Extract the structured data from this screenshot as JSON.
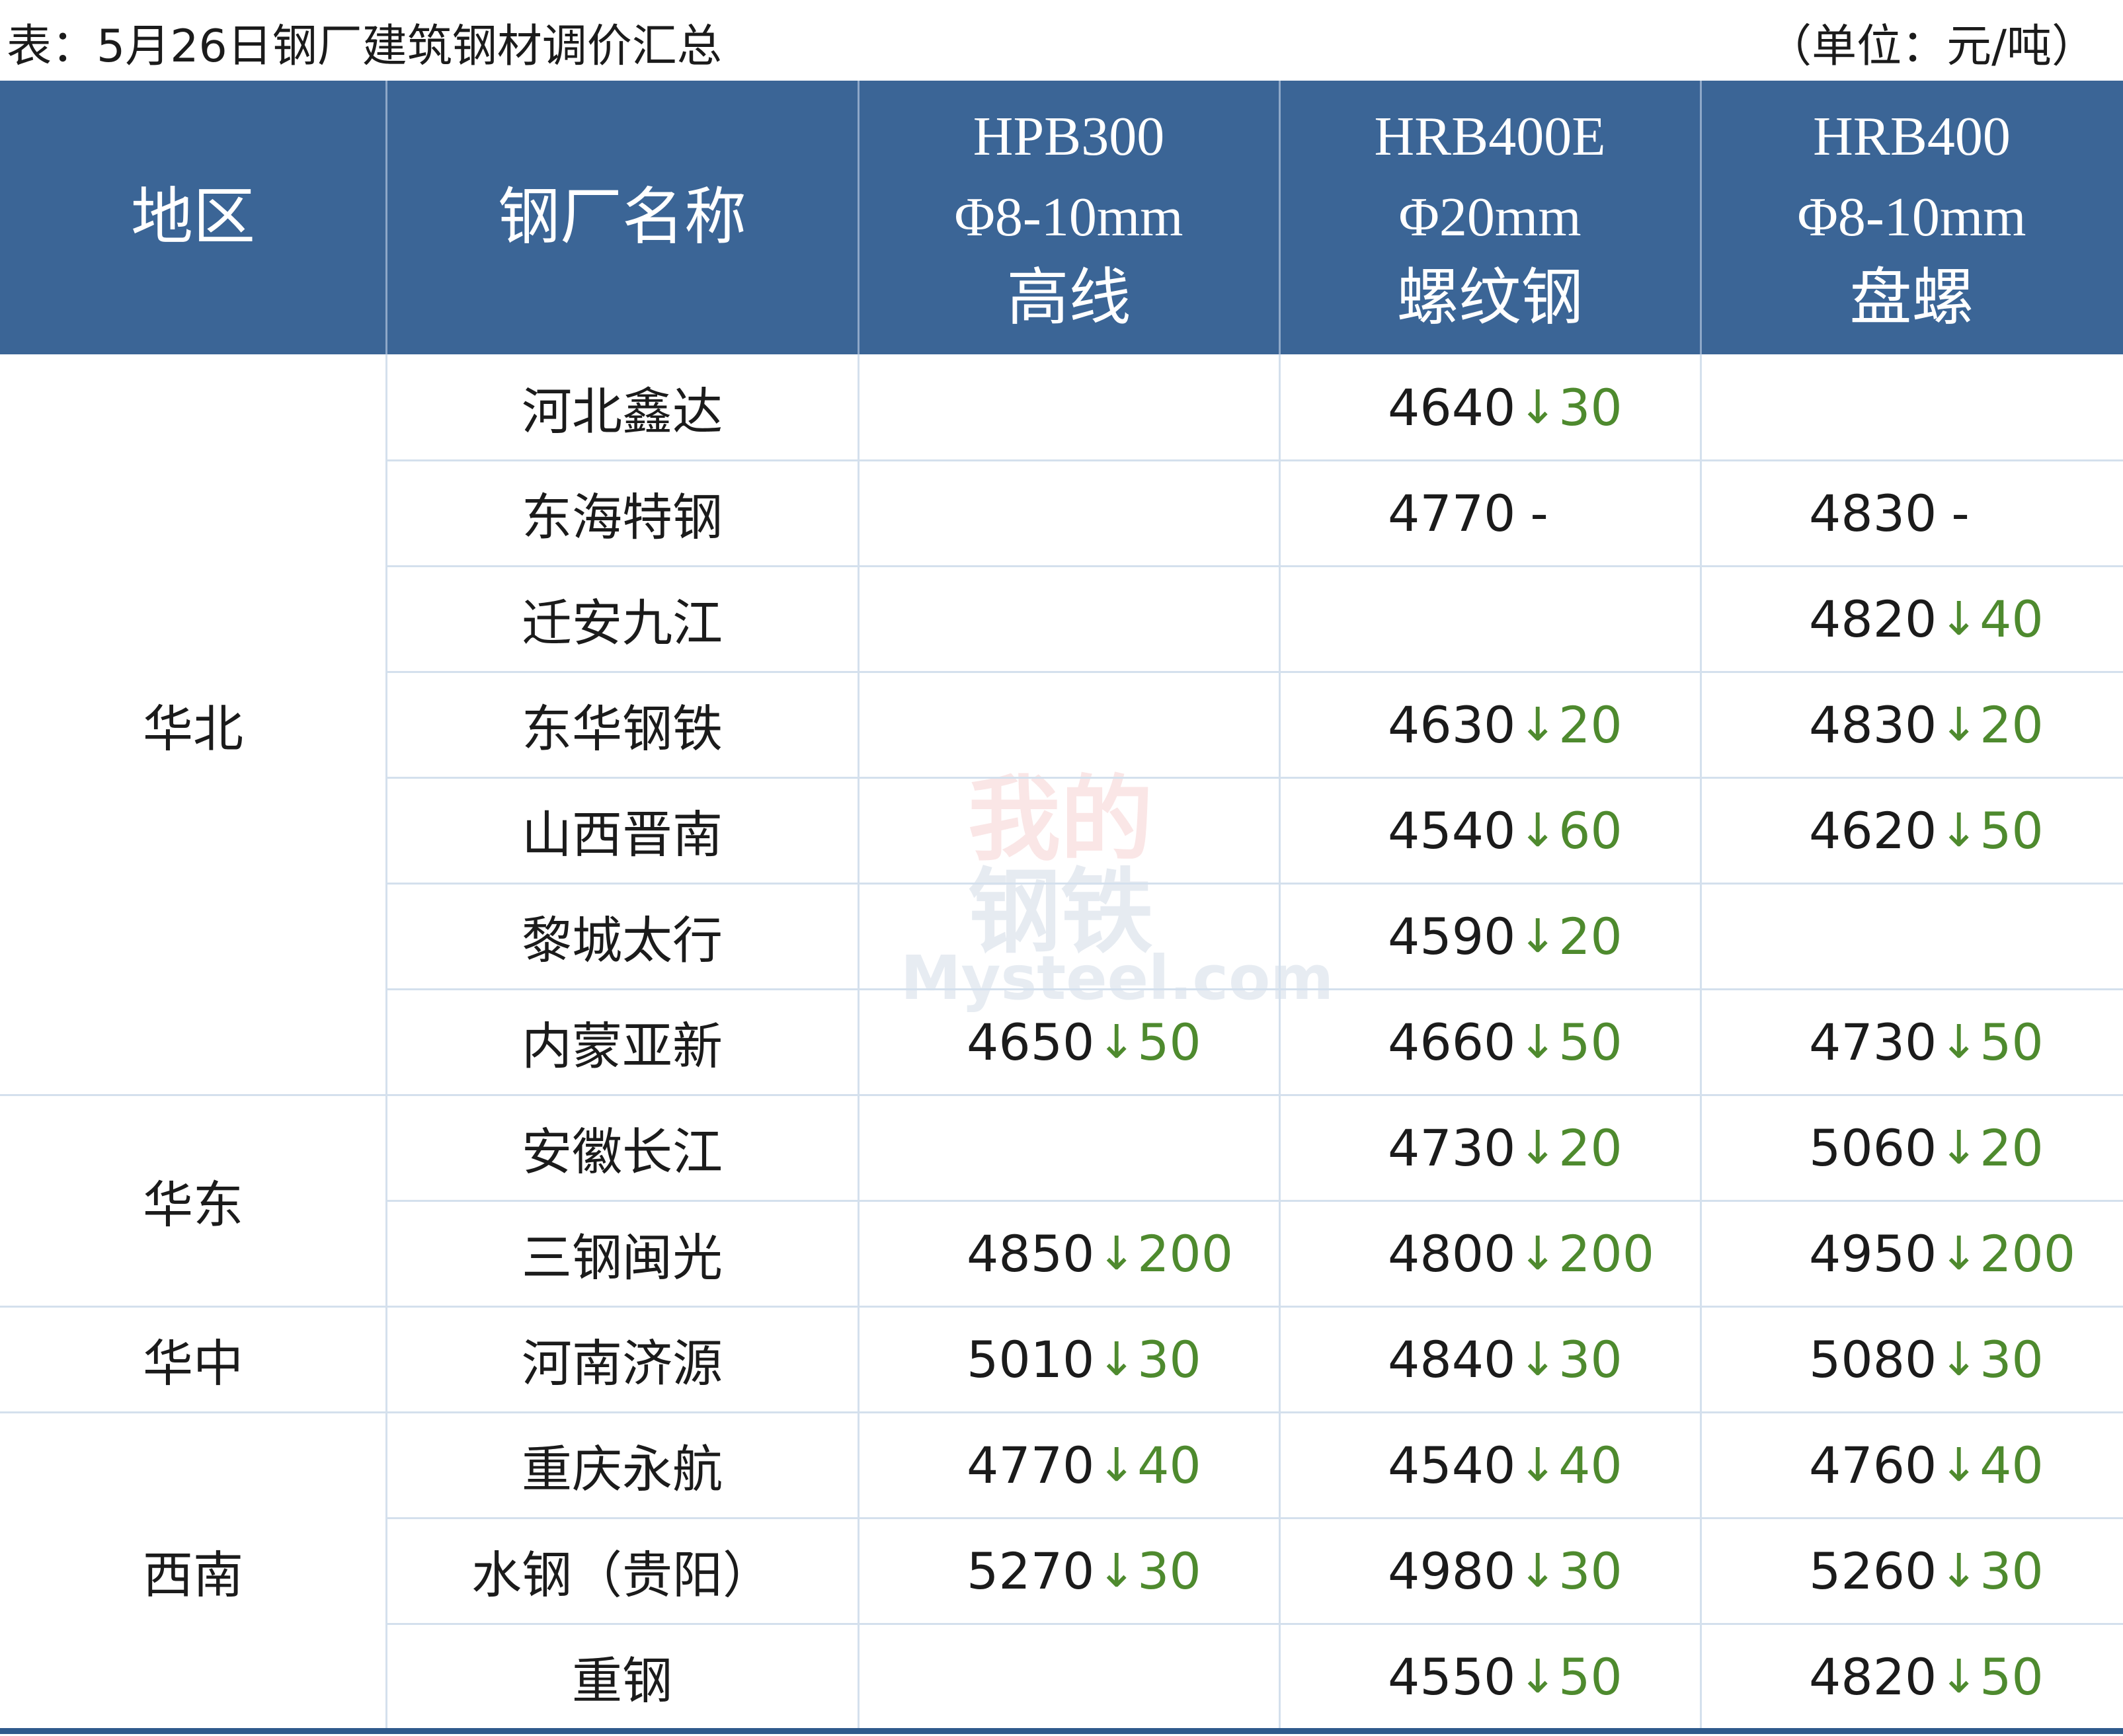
{
  "title": "表：5月26日钢厂建筑钢材调价汇总",
  "unit": "（单位：元/吨）",
  "header": {
    "region": "地区",
    "mill": "钢厂名称",
    "products": [
      {
        "grade": "HPB300",
        "spec": "Φ8-10mm",
        "type": "高线"
      },
      {
        "grade": "HRB400E",
        "spec": "Φ20mm",
        "type": "螺纹钢"
      },
      {
        "grade": "HRB400",
        "spec": "Φ8-10mm",
        "type": "盘螺"
      }
    ]
  },
  "groups": [
    {
      "region": "华北",
      "rows": [
        {
          "mill": "河北鑫达",
          "prices": [
            null,
            {
              "price": "4640",
              "arrow": "↓",
              "change": "30"
            },
            null
          ]
        },
        {
          "mill": "东海特钢",
          "prices": [
            null,
            {
              "price": "4770",
              "change": "-"
            },
            {
              "price": "4830",
              "change": "-"
            }
          ]
        },
        {
          "mill": "迁安九江",
          "prices": [
            null,
            null,
            {
              "price": "4820",
              "arrow": "↓",
              "change": "40"
            }
          ]
        },
        {
          "mill": "东华钢铁",
          "prices": [
            null,
            {
              "price": "4630",
              "arrow": "↓",
              "change": "20"
            },
            {
              "price": "4830",
              "arrow": "↓",
              "change": "20"
            }
          ]
        },
        {
          "mill": "山西晋南",
          "prices": [
            null,
            {
              "price": "4540",
              "arrow": "↓",
              "change": "60"
            },
            {
              "price": "4620",
              "arrow": "↓",
              "change": "50"
            }
          ]
        },
        {
          "mill": "黎城太行",
          "prices": [
            null,
            {
              "price": "4590",
              "arrow": "↓",
              "change": "20"
            },
            null
          ]
        },
        {
          "mill": "内蒙亚新",
          "prices": [
            {
              "price": "4650",
              "arrow": "↓",
              "change": "50"
            },
            {
              "price": "4660",
              "arrow": "↓",
              "change": "50"
            },
            {
              "price": "4730",
              "arrow": "↓",
              "change": "50"
            }
          ]
        }
      ]
    },
    {
      "region": "华东",
      "rows": [
        {
          "mill": "安徽长江",
          "prices": [
            null,
            {
              "price": "4730",
              "arrow": "↓",
              "change": "20"
            },
            {
              "price": "5060",
              "arrow": "↓",
              "change": "20"
            }
          ]
        },
        {
          "mill": "三钢闽光",
          "prices": [
            {
              "price": "4850",
              "arrow": "↓",
              "change": "200"
            },
            {
              "price": "4800",
              "arrow": "↓",
              "change": "200"
            },
            {
              "price": "4950",
              "arrow": "↓",
              "change": "200"
            }
          ]
        }
      ]
    },
    {
      "region": "华中",
      "rows": [
        {
          "mill": "河南济源",
          "prices": [
            {
              "price": "5010",
              "arrow": "↓",
              "change": "30"
            },
            {
              "price": "4840",
              "arrow": "↓",
              "change": "30"
            },
            {
              "price": "5080",
              "arrow": "↓",
              "change": "30"
            }
          ]
        }
      ]
    },
    {
      "region": "西南",
      "rows": [
        {
          "mill": "重庆永航",
          "prices": [
            {
              "price": "4770",
              "arrow": "↓",
              "change": "40"
            },
            {
              "price": "4540",
              "arrow": "↓",
              "change": "40"
            },
            {
              "price": "4760",
              "arrow": "↓",
              "change": "40"
            }
          ]
        },
        {
          "mill": "水钢（贵阳）",
          "prices": [
            {
              "price": "5270",
              "arrow": "↓",
              "change": "30"
            },
            {
              "price": "4980",
              "arrow": "↓",
              "change": "30"
            },
            {
              "price": "5260",
              "arrow": "↓",
              "change": "30"
            }
          ]
        },
        {
          "mill": "重钢",
          "prices": [
            null,
            {
              "price": "4550",
              "arrow": "↓",
              "change": "50"
            },
            {
              "price": "4820",
              "arrow": "↓",
              "change": "50"
            }
          ]
        }
      ]
    }
  ],
  "watermark": {
    "line1": "我的",
    "line2": "钢铁",
    "line3": "Mysteel.com"
  },
  "colors": {
    "header_bg": "#3b6596",
    "header_divider": "#8ea8c8",
    "grid": "#d4e0ed",
    "down": "#4e8a2e",
    "bottom_rule": "#2f5a8c",
    "text": "#1b1b1b"
  }
}
